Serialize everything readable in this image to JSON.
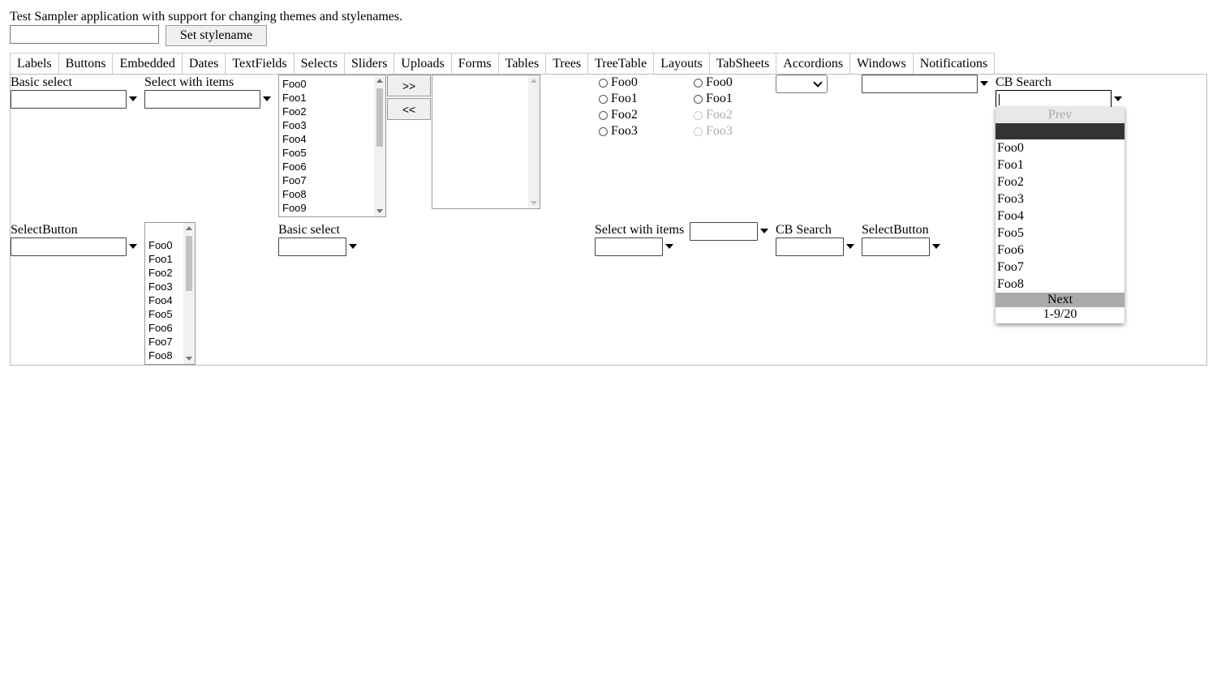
{
  "header": {
    "description": "Test Sampler application with support for changing themes and stylenames.",
    "stylename_input_value": "",
    "set_stylename_label": "Set stylename"
  },
  "tabs": [
    "Labels",
    "Buttons",
    "Embedded",
    "Dates",
    "TextFields",
    "Selects",
    "Sliders",
    "Uploads",
    "Forms",
    "Tables",
    "Trees",
    "TreeTable",
    "Layouts",
    "TabSheets",
    "Accordions",
    "Windows",
    "Notifications"
  ],
  "selects": {
    "row1": {
      "basic_select_caption": "Basic select",
      "select_with_items_caption": "Select with items",
      "listbox_items": [
        "Foo0",
        "Foo1",
        "Foo2",
        "Foo3",
        "Foo4",
        "Foo5",
        "Foo6",
        "Foo7",
        "Foo8",
        "Foo9"
      ],
      "twincol_add_label": ">>",
      "twincol_remove_label": "<<",
      "radio_group_1": [
        "Foo0",
        "Foo1",
        "Foo2",
        "Foo3"
      ],
      "radio_group_2": [
        "Foo0",
        "Foo1",
        "Foo2",
        "Foo3"
      ],
      "cb_search_caption": "CB Search",
      "cb_search_value": ""
    },
    "row2": {
      "selectbutton_caption": "SelectButton",
      "listbox_items": [
        "Foo0",
        "Foo1",
        "Foo2",
        "Foo3",
        "Foo4",
        "Foo5",
        "Foo6",
        "Foo7",
        "Foo8"
      ],
      "basic_select_caption": "Basic select",
      "select_with_items_caption": "Select with items",
      "cb_search_caption": "CB Search",
      "selectbutton2_caption": "SelectButton"
    },
    "popup": {
      "prev_label": "Prev",
      "items": [
        "Foo0",
        "Foo1",
        "Foo2",
        "Foo3",
        "Foo4",
        "Foo5",
        "Foo6",
        "Foo7",
        "Foo8"
      ],
      "next_label": "Next",
      "status": "1-9/20"
    }
  }
}
